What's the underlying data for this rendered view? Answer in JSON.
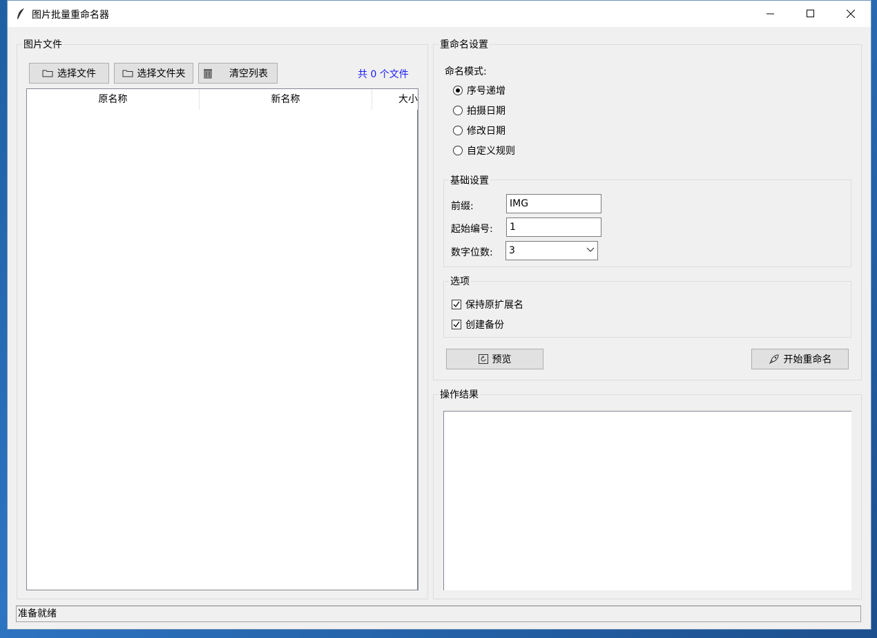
{
  "window": {
    "title": "图片批量重命名器",
    "controls": {
      "minimize": "minimize-icon",
      "maximize": "maximize-icon",
      "close": "close-icon"
    }
  },
  "files_panel": {
    "label": "图片文件",
    "buttons": {
      "select_files": "选择文件",
      "select_folder": "选择文件夹",
      "clear_list": "清空列表"
    },
    "file_count": "共 0 个文件",
    "columns": [
      "原名称",
      "新名称",
      "大小"
    ],
    "rows": []
  },
  "settings_panel": {
    "label": "重命名设置",
    "mode_label": "命名模式:",
    "modes": [
      {
        "label": "序号递增",
        "selected": true
      },
      {
        "label": "拍摄日期",
        "selected": false
      },
      {
        "label": "修改日期",
        "selected": false
      },
      {
        "label": "自定义规则",
        "selected": false
      }
    ],
    "basic": {
      "label": "基础设置",
      "prefix_label": "前缀:",
      "prefix_value": "IMG",
      "start_label": "起始编号:",
      "start_value": "1",
      "digits_label": "数字位数:",
      "digits_value": "3"
    },
    "options": {
      "label": "选项",
      "keep_ext": {
        "label": "保持原扩展名",
        "checked": true
      },
      "backup": {
        "label": "创建备份",
        "checked": true
      }
    },
    "preview_button": "预览",
    "start_button": "开始重命名"
  },
  "results_panel": {
    "label": "操作结果",
    "text": ""
  },
  "status": {
    "text": "准备就绪"
  },
  "colors": {
    "count_text": "#1a1aff",
    "window_bg": "#f0f0f0",
    "desktop": "#2d74c2"
  }
}
